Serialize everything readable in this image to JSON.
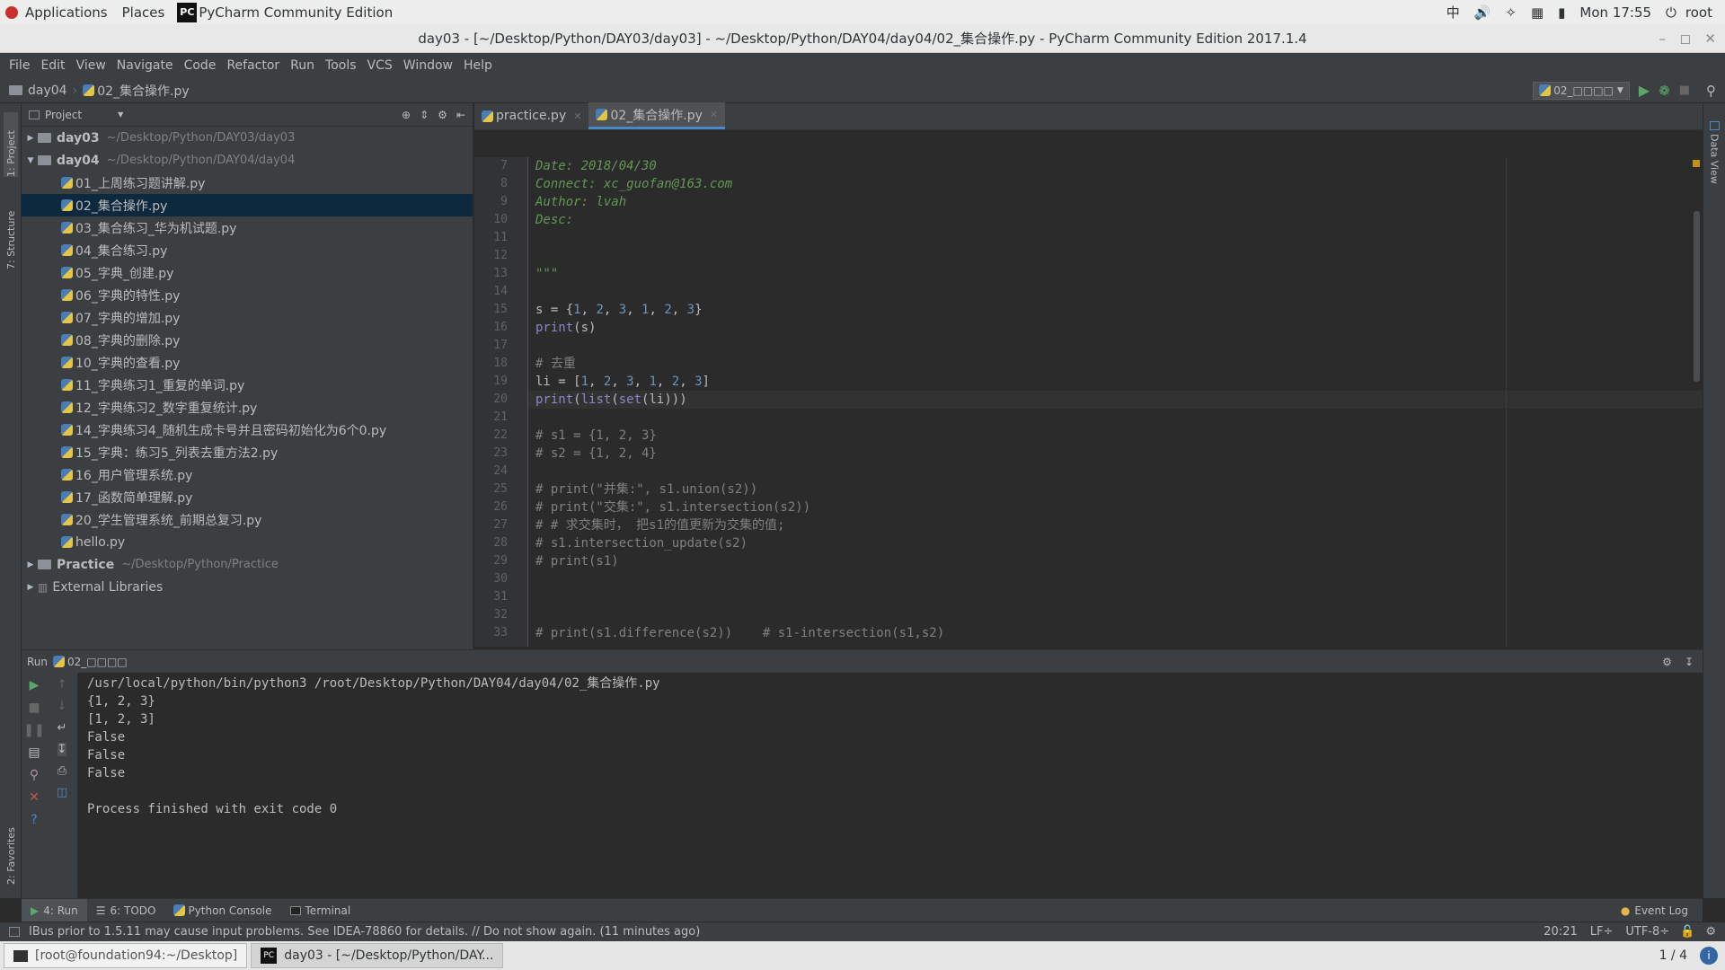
{
  "gnome": {
    "applications": "Applications",
    "places": "Places",
    "app_name": "PyCharm Community Edition",
    "ime": "中",
    "clock": "Mon 17:55",
    "user": "root"
  },
  "window_title": "day03 - [~/Desktop/Python/DAY03/day03] - ~/Desktop/Python/DAY04/day04/02_集合操作.py - PyCharm Community Edition 2017.1.4",
  "menu": [
    "File",
    "Edit",
    "View",
    "Navigate",
    "Code",
    "Refactor",
    "Run",
    "Tools",
    "VCS",
    "Window",
    "Help"
  ],
  "nav": {
    "folder": "day04",
    "file": "02_集合操作.py",
    "run_config": "02_□□□□"
  },
  "side_tabs": {
    "project": "1: Project",
    "structure": "7: Structure",
    "favorites": "2: Favorites",
    "data_view": "Data View"
  },
  "project": {
    "header": "Project",
    "tree": [
      {
        "name": "day03",
        "path": "~/Desktop/Python/DAY03/day03",
        "kind": "folder",
        "expanded": false
      },
      {
        "name": "day04",
        "path": "~/Desktop/Python/DAY04/day04",
        "kind": "folder",
        "expanded": true
      },
      {
        "name": "01_上周练习题讲解.py",
        "kind": "file"
      },
      {
        "name": "02_集合操作.py",
        "kind": "file",
        "selected": true
      },
      {
        "name": "03_集合练习_华为机试题.py",
        "kind": "file"
      },
      {
        "name": "04_集合练习.py",
        "kind": "file"
      },
      {
        "name": "05_字典_创建.py",
        "kind": "file"
      },
      {
        "name": "06_字典的特性.py",
        "kind": "file"
      },
      {
        "name": "07_字典的增加.py",
        "kind": "file"
      },
      {
        "name": "08_字典的删除.py",
        "kind": "file"
      },
      {
        "name": "10_字典的查看.py",
        "kind": "file"
      },
      {
        "name": "11_字典练习1_重复的单词.py",
        "kind": "file"
      },
      {
        "name": "12_字典练习2_数字重复统计.py",
        "kind": "file"
      },
      {
        "name": "14_字典练习4_随机生成卡号并且密码初始化为6个0.py",
        "kind": "file"
      },
      {
        "name": "15_字典：练习5_列表去重方法2.py",
        "kind": "file"
      },
      {
        "name": "16_用户管理系统.py",
        "kind": "file"
      },
      {
        "name": "17_函数简单理解.py",
        "kind": "file"
      },
      {
        "name": "20_学生管理系统_前期总复习.py",
        "kind": "file"
      },
      {
        "name": "hello.py",
        "kind": "file"
      },
      {
        "name": "Practice",
        "path": "~/Desktop/Python/Practice",
        "kind": "folder",
        "expanded": false
      },
      {
        "name": "External Libraries",
        "kind": "lib",
        "expanded": false
      }
    ]
  },
  "editor": {
    "tabs": [
      {
        "label": "practice.py",
        "active": false
      },
      {
        "label": "02_集合操作.py",
        "active": true
      }
    ],
    "lines": [
      {
        "n": "7",
        "text": "Date: 2018/04/30",
        "cls": "doc"
      },
      {
        "n": "8",
        "text": "Connect: xc_guofan@163.com",
        "cls": "doc"
      },
      {
        "n": "9",
        "text": "Author: lvah",
        "cls": "doc"
      },
      {
        "n": "10",
        "text": "Desc:",
        "cls": "doc"
      },
      {
        "n": "11",
        "text": "",
        "cls": ""
      },
      {
        "n": "12",
        "text": "",
        "cls": ""
      },
      {
        "n": "13",
        "text": "\"\"\"",
        "cls": "doc"
      },
      {
        "n": "14",
        "text": "",
        "cls": ""
      },
      {
        "n": "15",
        "text": "s = {1, 2, 3, 1, 2, 3}",
        "cls": "code"
      },
      {
        "n": "16",
        "text": "print(s)",
        "cls": "code"
      },
      {
        "n": "17",
        "text": "",
        "cls": ""
      },
      {
        "n": "18",
        "text": "# 去重",
        "cls": "cm"
      },
      {
        "n": "19",
        "text": "li = [1, 2, 3, 1, 2, 3]",
        "cls": "code"
      },
      {
        "n": "20",
        "text": "print(list(set(li)))",
        "cls": "code",
        "current": true
      },
      {
        "n": "21",
        "text": "",
        "cls": ""
      },
      {
        "n": "22",
        "text": "# s1 = {1, 2, 3}",
        "cls": "cm"
      },
      {
        "n": "23",
        "text": "# s2 = {1, 2, 4}",
        "cls": "cm"
      },
      {
        "n": "24",
        "text": "",
        "cls": ""
      },
      {
        "n": "25",
        "text": "# print(\"并集:\", s1.union(s2))",
        "cls": "cm"
      },
      {
        "n": "26",
        "text": "# print(\"交集:\", s1.intersection(s2))",
        "cls": "cm"
      },
      {
        "n": "27",
        "text": "# # 求交集时， 把s1的值更新为交集的值;",
        "cls": "cm"
      },
      {
        "n": "28",
        "text": "# s1.intersection_update(s2)",
        "cls": "cm"
      },
      {
        "n": "29",
        "text": "# print(s1)",
        "cls": "cm"
      },
      {
        "n": "30",
        "text": "",
        "cls": ""
      },
      {
        "n": "31",
        "text": "",
        "cls": ""
      },
      {
        "n": "32",
        "text": "",
        "cls": ""
      },
      {
        "n": "33",
        "text": "# print(s1.difference(s2))    # s1-intersection(s1,s2)",
        "cls": "cm"
      }
    ]
  },
  "run": {
    "header_label": "Run",
    "config": "02_□□□□",
    "output": [
      "/usr/local/python/bin/python3 /root/Desktop/Python/DAY04/day04/02_集合操作.py",
      "{1, 2, 3}",
      "[1, 2, 3]",
      "False",
      "False",
      "False",
      "",
      "Process finished with exit code 0"
    ]
  },
  "bottom_tabs": {
    "run": "4: Run",
    "todo": "6: TODO",
    "console": "Python Console",
    "terminal": "Terminal",
    "event_log": "Event Log"
  },
  "status": {
    "message": "IBus prior to 1.5.11 may cause input problems. See IDEA-78860 for details. // Do not show again. (11 minutes ago)",
    "position": "20:21",
    "line_sep": "LF÷",
    "encoding": "UTF-8÷"
  },
  "taskbar": {
    "task1": "[root@foundation94:~/Desktop]",
    "task2": "day03 - [~/Desktop/Python/DAY...",
    "workspace": "1 / 4"
  },
  "colors": {
    "accent": "#4a88c7",
    "run_green": "#59a869",
    "stop_red": "#c75450",
    "bg": "#2b2b2b"
  }
}
